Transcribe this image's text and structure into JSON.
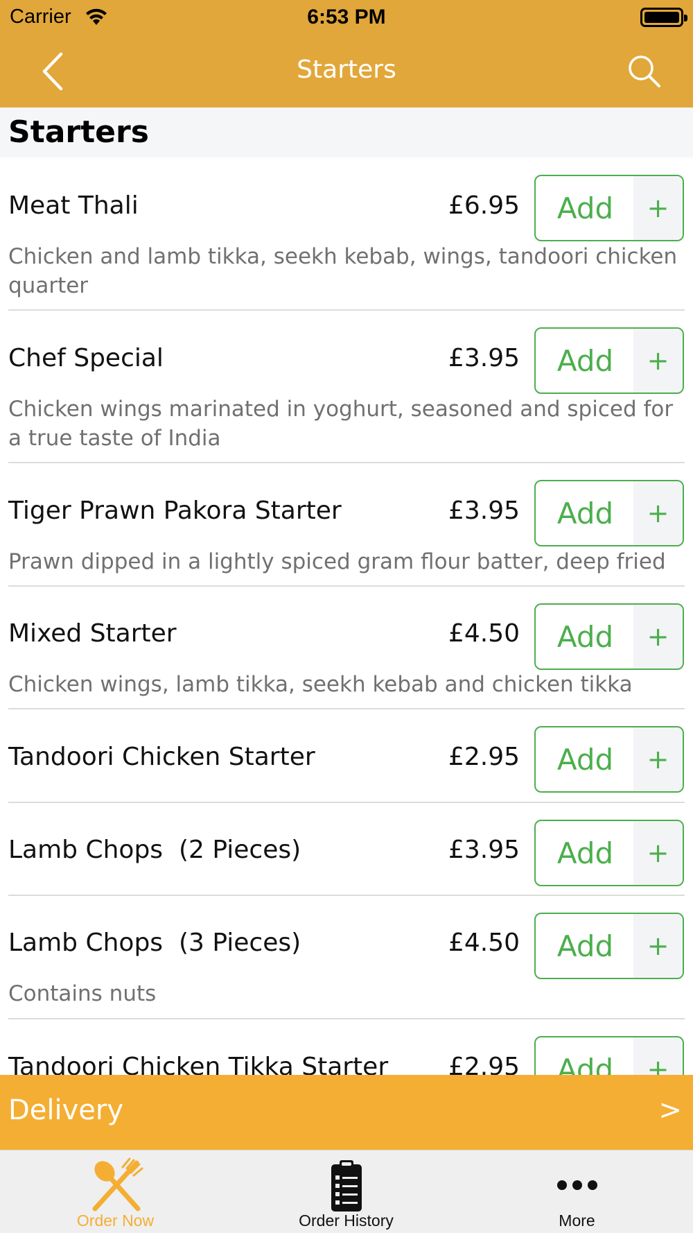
{
  "status_bar": {
    "carrier": "Carrier",
    "time": "6:53 PM"
  },
  "nav": {
    "title": "Starters",
    "back_icon": "chevron-left-icon",
    "search_icon": "search-icon"
  },
  "section": {
    "title": "Starters"
  },
  "add_button": {
    "label": "Add",
    "plus": "+"
  },
  "items": [
    {
      "name": "Meat Thali",
      "price": "£6.95",
      "description": "Chicken and lamb tikka, seekh kebab, wings, tandoori chicken quarter"
    },
    {
      "name": "Chef Special",
      "price": "£3.95",
      "description": "Chicken wings marinated in yoghurt, seasoned and spiced for a true taste of India"
    },
    {
      "name": "Tiger Prawn Pakora Starter",
      "price": "£3.95",
      "description": "Prawn dipped in a lightly spiced gram flour batter, deep fried"
    },
    {
      "name": "Mixed Starter",
      "price": "£4.50",
      "description": "Chicken wings, lamb tikka, seekh kebab and chicken tikka"
    },
    {
      "name": "Tandoori Chicken Starter",
      "price": "£2.95",
      "description": ""
    },
    {
      "name": "Lamb Chops  (2 Pieces)",
      "price": "£3.95",
      "description": ""
    },
    {
      "name": "Lamb Chops  (3 Pieces)",
      "price": "£4.50",
      "description": "Contains nuts"
    },
    {
      "name": "Tandoori Chicken Tikka Starter",
      "price": "£2.95",
      "description": ""
    }
  ],
  "delivery": {
    "label": "Delivery",
    "arrow": ">"
  },
  "tabs": [
    {
      "label": "Order Now",
      "icon": "fork-knife-icon",
      "active": true
    },
    {
      "label": "Order History",
      "icon": "clipboard-list-icon",
      "active": false
    },
    {
      "label": "More",
      "icon": "more-dots-icon",
      "active": false
    }
  ],
  "colors": {
    "header_bg": "#e2a73a",
    "delivery_bg": "#f4ae33",
    "add_green": "#4cae4c",
    "active_tab": "#f4ae33"
  }
}
